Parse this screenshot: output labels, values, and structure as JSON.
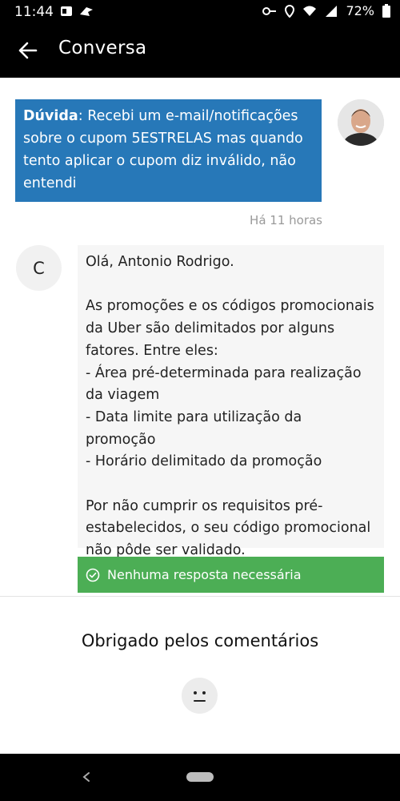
{
  "status_bar": {
    "time": "11:44",
    "battery": "72%"
  },
  "app_bar": {
    "title": "Conversa"
  },
  "user_message": {
    "label": "Dúvida",
    "text": ": Recebi um e-mail/notificações sobre o cupom 5ESTRELAS mas quando tento aplicar o cupom diz inválido, não entendi",
    "timestamp": "Há 11 horas"
  },
  "agent": {
    "initial": "C",
    "lines": {
      "greeting": "Olá, Antonio Rodrigo.",
      "intro": "As promoções e os códigos promocionais da Uber são delimitados por alguns fatores. Entre eles:",
      "item1": "- Área pré-determinada para realização da viagem",
      "item2": "- Data limite para utilização da promoção",
      "item3": "- Horário delimitado da promoção",
      "closing": "Por não cumprir os requisitos pré-estabelecidos, o seu código promocional não pôde ser validado."
    }
  },
  "status_banner": {
    "text": "Nenhuma resposta necessária",
    "color": "#4cae55"
  },
  "feedback": {
    "text": "Obrigado pelos comentários"
  },
  "colors": {
    "accent": "#2778b8",
    "bars": "#000000"
  }
}
